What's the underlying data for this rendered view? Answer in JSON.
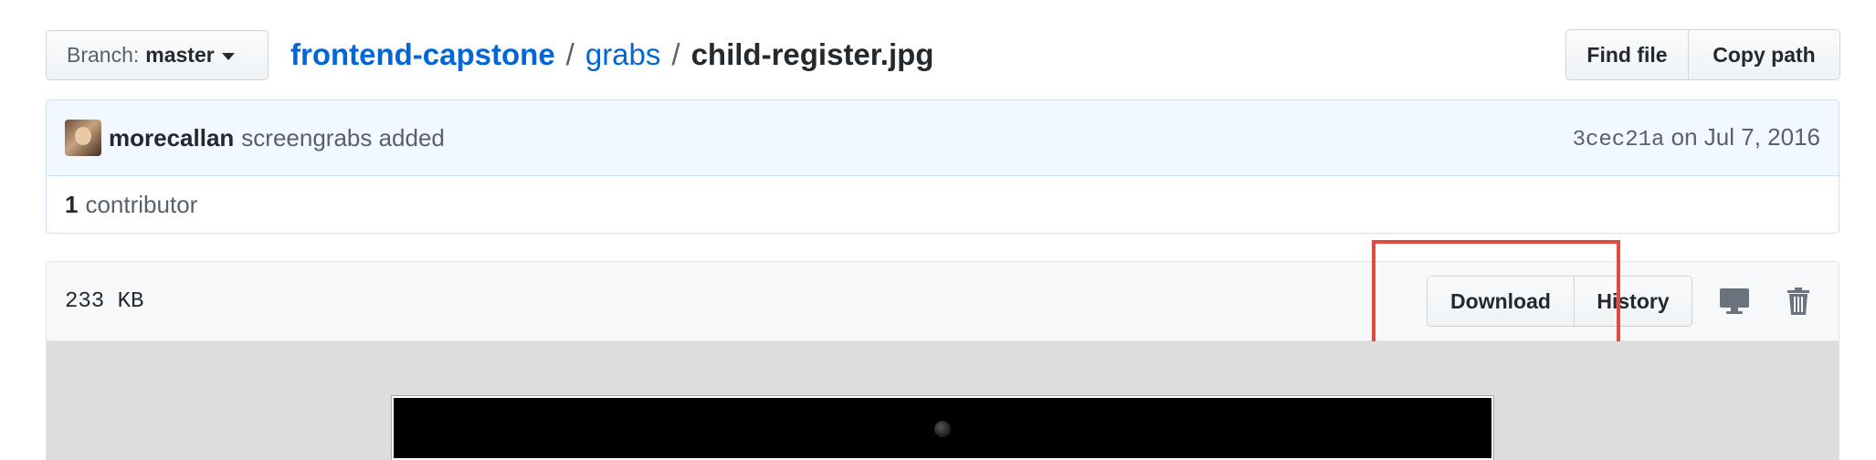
{
  "branch": {
    "label": "Branch:",
    "name": "master"
  },
  "breadcrumb": {
    "repo": "frontend-capstone",
    "sep": "/",
    "dir": "grabs",
    "file": "child-register.jpg"
  },
  "file_nav": {
    "find_file": "Find file",
    "copy_path": "Copy path"
  },
  "commit": {
    "author": "morecallan",
    "message": "screengrabs added",
    "sha": "3cec21a",
    "date": "on Jul 7, 2016"
  },
  "contributors": {
    "count": "1",
    "label": "contributor"
  },
  "file": {
    "size": "233 KB",
    "download": "Download",
    "history": "History",
    "icons": [
      "desktop-icon",
      "trashcan-icon"
    ]
  },
  "colors": {
    "link": "#0366d6",
    "highlight_box": "#e04b3e",
    "commit_bg": "#f1f8ff"
  }
}
